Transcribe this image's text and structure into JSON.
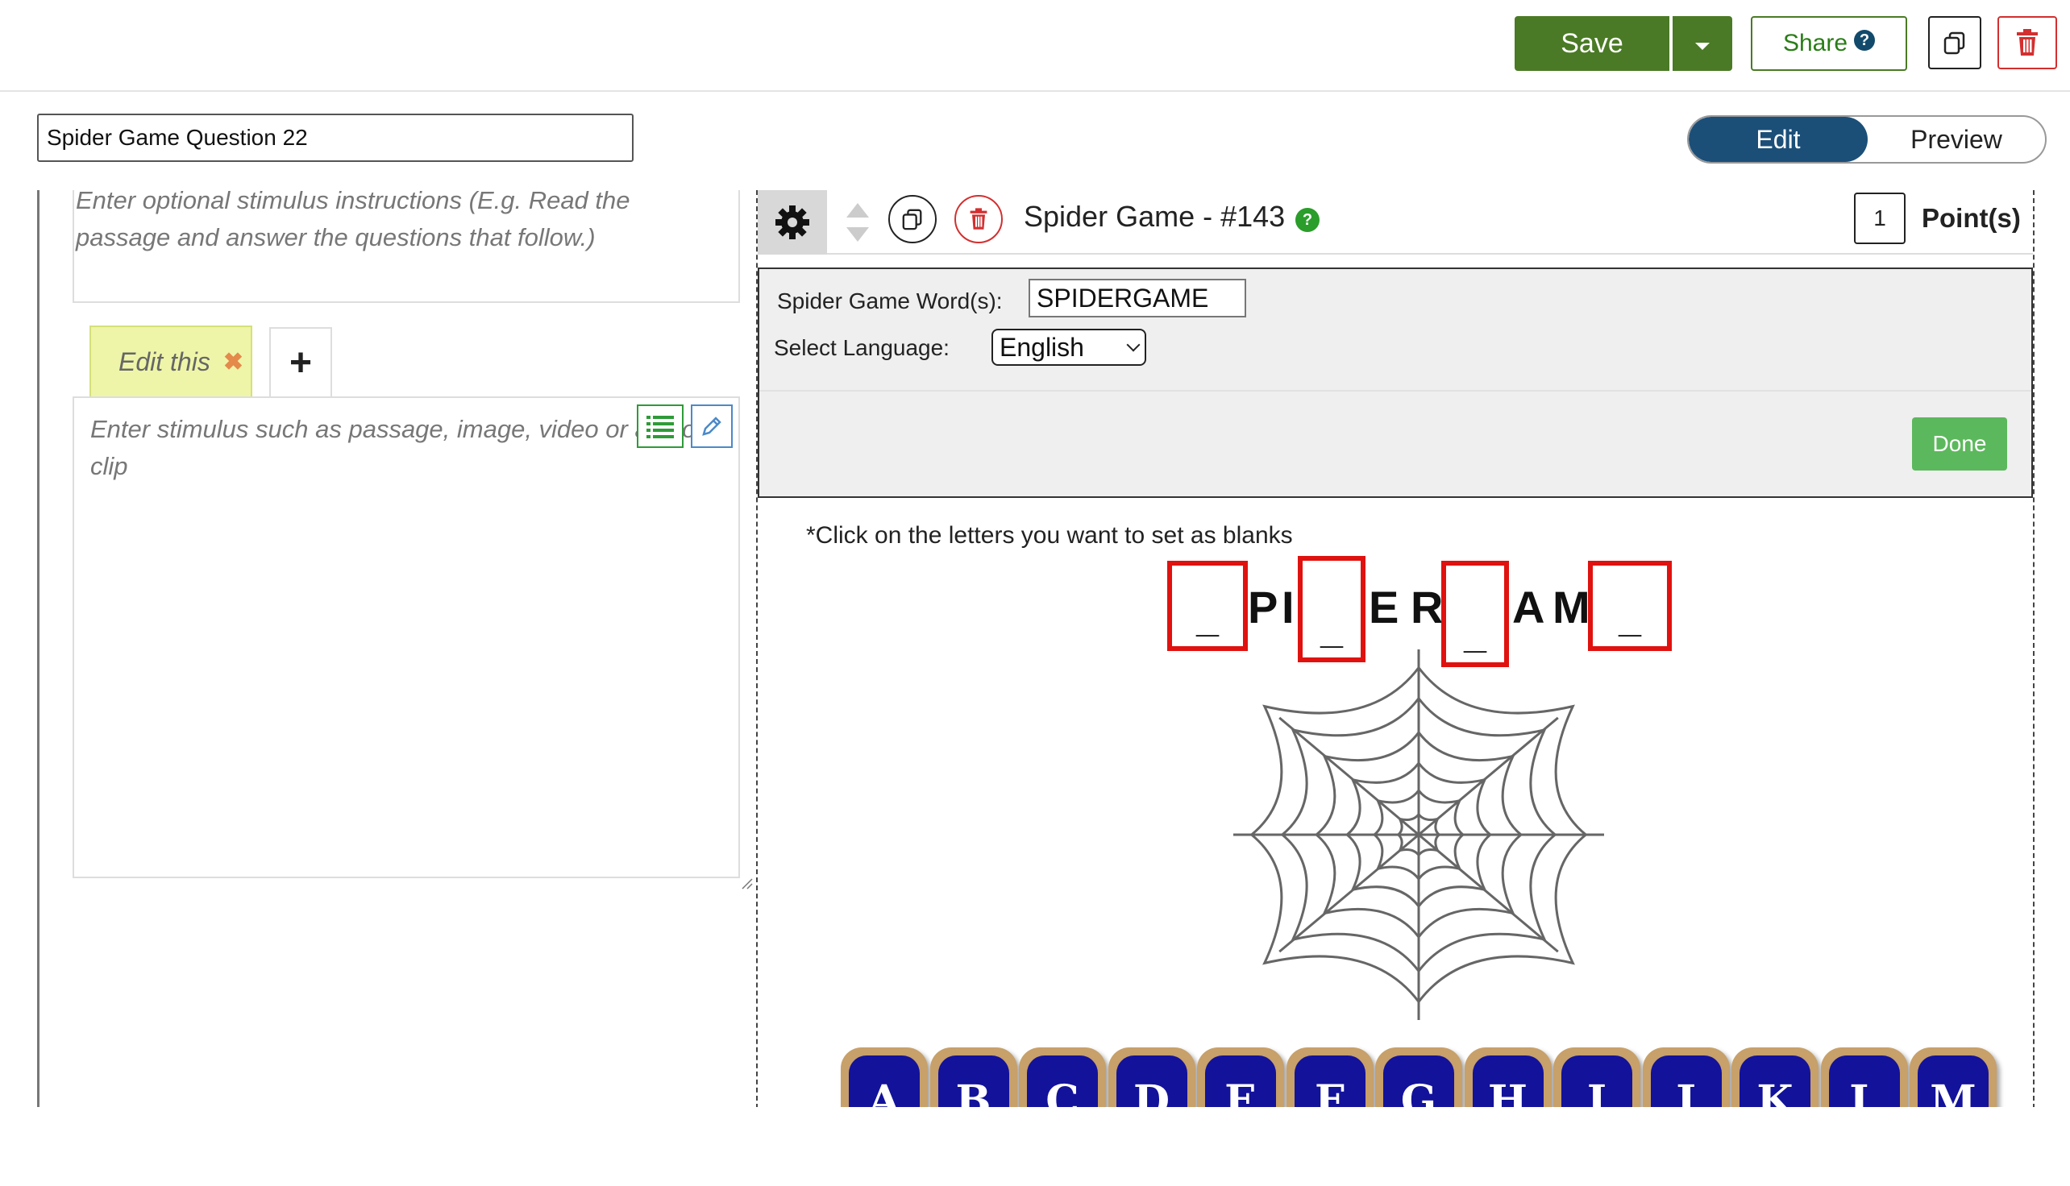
{
  "toolbar": {
    "save_label": "Save",
    "share_label": "Share",
    "share_help_glyph": "?",
    "icons": {
      "copy": "copy-icon",
      "delete": "trash-icon",
      "dropdown": "caret-down-icon"
    }
  },
  "title_input": {
    "value": "Spider Game Question 22"
  },
  "mode_toggle": {
    "edit_label": "Edit",
    "preview_label": "Preview",
    "active": "Edit"
  },
  "stimulus": {
    "instructions_placeholder": "Enter optional stimulus instructions (E.g. Read the passage and answer the questions that follow.)",
    "tab_label": "Edit this",
    "tab_close_glyph": "✖",
    "add_tab_glyph": "+",
    "content_placeholder": "Enter stimulus such as passage, image, video or audio clip"
  },
  "question": {
    "title": "Spider Game - #143",
    "help_glyph": "?",
    "points_value": "1",
    "points_label": "Point(s)",
    "settings": {
      "word_label": "Spider Game Word(s):",
      "word_value": "SPIDERGAME",
      "language_label": "Select Language:",
      "language_value": "English",
      "done_label": "Done"
    },
    "hint": "*Click on the letters you want to set as blanks",
    "word_display": [
      {
        "char": "_",
        "blank": true
      },
      {
        "char": "P",
        "blank": false
      },
      {
        "char": "I",
        "blank": false
      },
      {
        "char": "_",
        "blank": true
      },
      {
        "char": "E",
        "blank": false
      },
      {
        "char": "R",
        "blank": false
      },
      {
        "char": "_",
        "blank": true
      },
      {
        "char": "A",
        "blank": false
      },
      {
        "char": "M",
        "blank": false
      },
      {
        "char": "_",
        "blank": true
      }
    ],
    "keyboard": [
      "A",
      "B",
      "C",
      "D",
      "E",
      "F",
      "G",
      "H",
      "I",
      "J",
      "K",
      "L",
      "M"
    ]
  },
  "colors": {
    "save_green": "#4a7a25",
    "toggle_blue": "#1b4f78",
    "blank_red": "#e0120f",
    "key_blue": "#13129a",
    "key_tan": "#c7a06a",
    "done_green": "#5cb85c"
  }
}
